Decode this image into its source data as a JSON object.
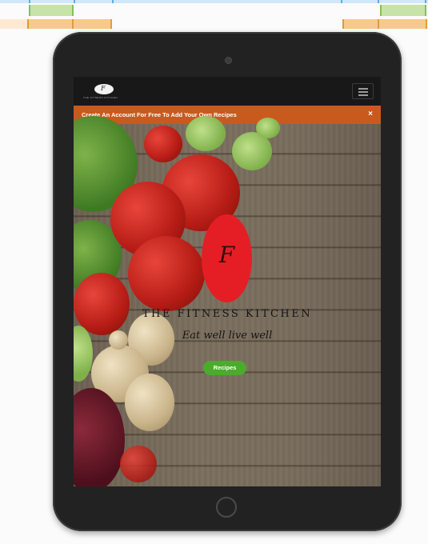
{
  "brand": {
    "logo_mark": "F",
    "logo_text": "THE FITNESS KITCHEN"
  },
  "navbar": {
    "menu_icon": "hamburger-icon"
  },
  "banner": {
    "text": "Create An Account For Free To Add Your Own Recipes",
    "close_label": "×"
  },
  "hero": {
    "logo_mark": "F",
    "title": "THE FITNESS KITCHEN",
    "tagline": "Eat well live well",
    "button_label": "Recipes"
  },
  "colors": {
    "banner": "#c95a1d",
    "logo": "#e51e25",
    "button": "#4bab2c"
  }
}
